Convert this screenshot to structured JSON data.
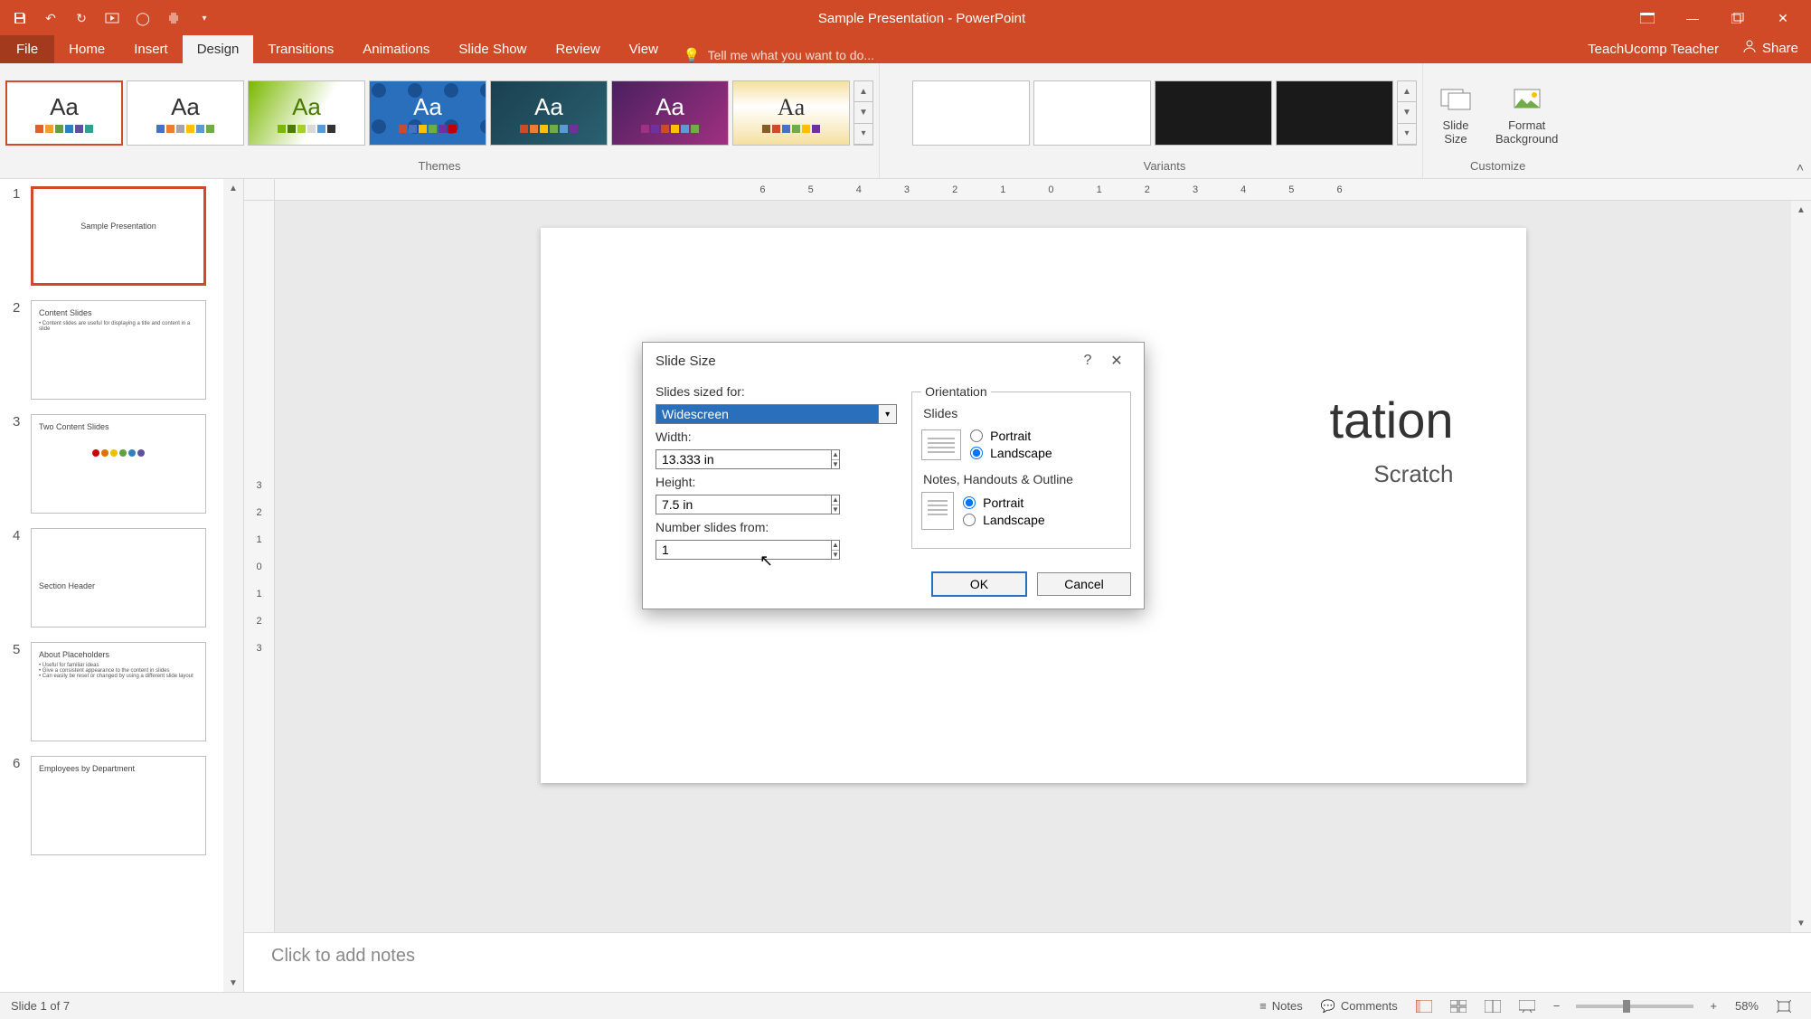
{
  "title": "Sample Presentation - PowerPoint",
  "user": "TeachUcomp Teacher",
  "share": "Share",
  "tabs": {
    "file": "File",
    "home": "Home",
    "insert": "Insert",
    "design": "Design",
    "transitions": "Transitions",
    "animations": "Animations",
    "slideshow": "Slide Show",
    "review": "Review",
    "view": "View"
  },
  "tellme_placeholder": "Tell me what you want to do...",
  "groups": {
    "themes": "Themes",
    "variants": "Variants",
    "customize": "Customize"
  },
  "customize": {
    "slide_size": "Slide\nSize",
    "format_background": "Format\nBackground"
  },
  "thumbs": [
    {
      "n": "1",
      "title": "Sample Presentation",
      "sub": ""
    },
    {
      "n": "2",
      "title": "Content Slides",
      "sub": ""
    },
    {
      "n": "3",
      "title": "Two Content Slides",
      "sub": ""
    },
    {
      "n": "4",
      "title": "Section Header",
      "sub": ""
    },
    {
      "n": "5",
      "title": "About Placeholders",
      "sub": ""
    },
    {
      "n": "6",
      "title": "Employees by Department",
      "sub": ""
    }
  ],
  "slide": {
    "title": "tation",
    "subtitle": "Scratch"
  },
  "notes_placeholder": "Click to add notes",
  "status": {
    "slide_counter": "Slide 1 of 7",
    "notes": "Notes",
    "comments": "Comments",
    "zoom": "58%"
  },
  "dialog": {
    "title": "Slide Size",
    "sized_for_label": "Slides sized for:",
    "sized_for_value": "Widescreen",
    "width_label": "Width:",
    "width_value": "13.333 in",
    "height_label": "Height:",
    "height_value": "7.5 in",
    "number_label": "Number slides from:",
    "number_value": "1",
    "orientation": "Orientation",
    "slides_group": "Slides",
    "notes_group": "Notes, Handouts & Outline",
    "portrait": "Portrait",
    "landscape": "Landscape",
    "ok": "OK",
    "cancel": "Cancel"
  },
  "ruler_h": "6 5 4 3 2 1 0 1 2 3 4 5 6",
  "colors": {
    "accent": "#d04a27",
    "highlight": "#2a6fbb"
  }
}
